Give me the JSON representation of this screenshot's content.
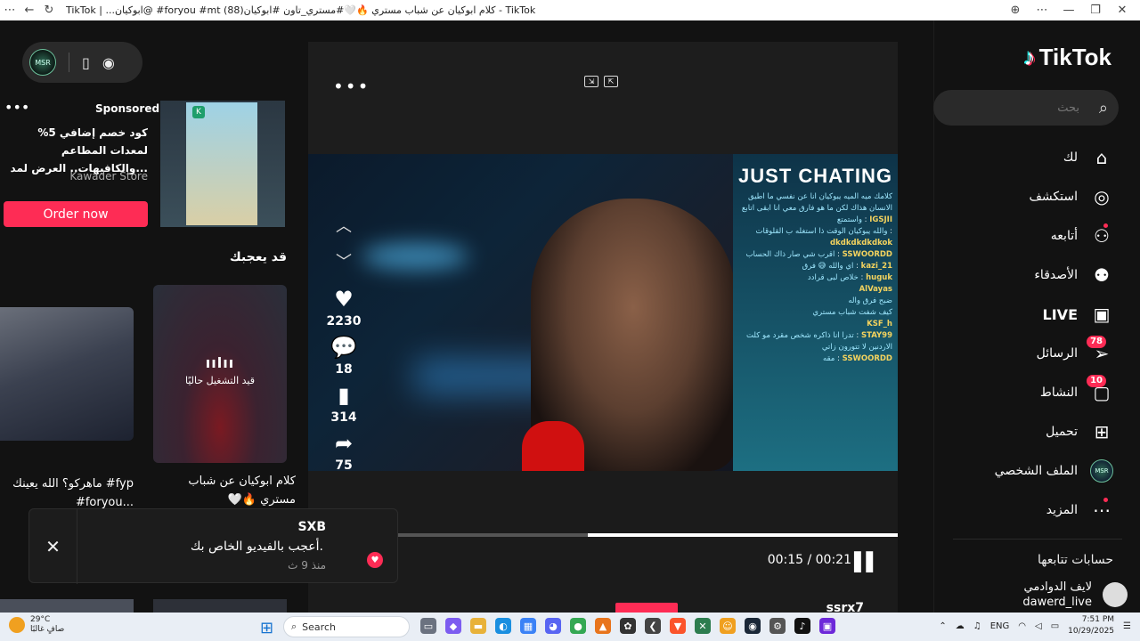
{
  "window": {
    "title": "TikTok | ...ابوكيان@ #foryou #mt كلام ابوكيان عن شباب مستري 🔥🤍#مستري_تاون #ابوكيان(88) - TikTok"
  },
  "sidebar": {
    "logo": "TikTok",
    "search_placeholder": "بحث",
    "items": [
      {
        "label": "لك",
        "icon": "home-icon"
      },
      {
        "label": "استكشف",
        "icon": "compass-icon"
      },
      {
        "label": "أتابعه",
        "icon": "user-follow-icon"
      },
      {
        "label": "الأصدقاء",
        "icon": "friends-icon"
      },
      {
        "label": "LIVE",
        "icon": "live-icon"
      },
      {
        "label": "الرسائل",
        "icon": "send-icon",
        "badge": "78"
      },
      {
        "label": "النشاط",
        "icon": "activity-icon",
        "badge": "10"
      },
      {
        "label": "تحميل",
        "icon": "upload-icon"
      },
      {
        "label": "الملف الشخصي",
        "icon": "profile-avatar"
      },
      {
        "label": "المزيد",
        "icon": "more-icon"
      }
    ],
    "following_heading": "حسابات تتابعها",
    "following": [
      {
        "display_name": "لايف الدوادمي",
        "handle": "dawerd_live"
      }
    ],
    "avatar_text": "MSR"
  },
  "player": {
    "likes": "2230",
    "comments": "18",
    "saves": "314",
    "shares": "75",
    "time": "00:15 / 00:21",
    "progress": 0.62,
    "owner": "ssrx7",
    "overlay_title": "JUST CHATING",
    "chat": [
      {
        "user": "IGSJII",
        "text": "كلامك ميه الميه يبوكيان انا عن نفسي ما اطيق الانسان هذاك لكن ما هو فارق معي انا ابقى اتابع واستمتع"
      },
      {
        "user": "dkdkdkdkdkok",
        "text": "والله يبوكيان الوقت ذا استغله ب القلوقات"
      },
      {
        "user": "SSWOORDD",
        "text": "اقرب شي صار ذاك الحساب"
      },
      {
        "user": "kazi_21",
        "text": "اي والله 😅 فرق"
      },
      {
        "user": "huguk",
        "text": "خلاص لبى قرادد"
      },
      {
        "user": "AlVayas",
        "text": ""
      },
      {
        "user": "",
        "text": "ضبح فرق واله"
      },
      {
        "user": "",
        "text": "كيف شفت شباب مستري"
      },
      {
        "user": "KSF_h",
        "text": ""
      },
      {
        "user": "STAY99",
        "text": "تدرا انا ذاكره شخص مقرد مو كلت"
      },
      {
        "user": "",
        "text": "الاردنين لا تتورون زاتي"
      },
      {
        "user": "SSWOORDD",
        "text": "مقه"
      }
    ]
  },
  "left": {
    "avatar_text": "MSR",
    "ad": {
      "sponsored": "Sponsored",
      "copy": "كود خصم إضافي 5% لمعدات المطاعم والكافيهات.. العرض لمد...",
      "store": "Kawader Store",
      "cta": "Order now"
    },
    "suggest_heading": "قد يعجبك",
    "cards": [
      {
        "overlay_wave": "ıılıı",
        "overlay_label": "قيد التشغيل حاليًا",
        "caption": "كلام ابوكيان عن شباب مستري 🔥🤍 #مستري_تاون..."
      },
      {
        "caption": "ماهركو؟ الله يعينك #fyp #foryou..."
      }
    ],
    "toast": {
      "name": "SXB",
      "message": "أعجب بالفيديو الخاص بك.",
      "ago": "منذ 9 ث"
    }
  },
  "taskbar": {
    "weather_temp": "29°C",
    "weather_desc": "صافٍ غالبًا",
    "search": "Search",
    "lang": "ENG",
    "time": "7:51 PM",
    "date": "10/29/2025"
  },
  "colors": {
    "accent": "#fe2c55",
    "background": "#121212"
  }
}
